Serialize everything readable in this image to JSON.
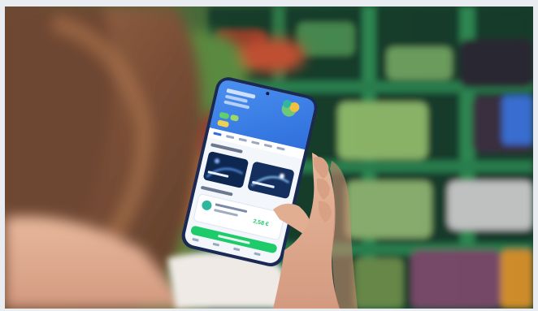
{
  "photo": {
    "subject": "shopper-using-grocery-app",
    "accent_colors": {
      "shelf_green": "#2e7a4a",
      "app_green": "#1ecb6b",
      "app_blue": "#3f7fe8",
      "hair": "#8a5a3c"
    }
  },
  "app_screen": {
    "price_label": "2,58 €"
  }
}
